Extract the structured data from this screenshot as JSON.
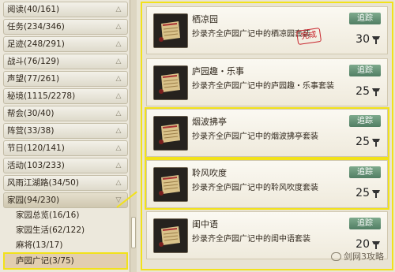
{
  "sidebar": {
    "categories": [
      {
        "label": "阅读(40/161)"
      },
      {
        "label": "任务(234/346)"
      },
      {
        "label": "足迹(248/291)"
      },
      {
        "label": "战斗(76/129)"
      },
      {
        "label": "声望(77/261)"
      },
      {
        "label": "秘境(1115/2278)"
      },
      {
        "label": "帮会(30/40)"
      },
      {
        "label": "阵营(33/38)"
      },
      {
        "label": "节日(120/141)"
      },
      {
        "label": "活动(103/233)"
      },
      {
        "label": "风雨江湖路(34/50)"
      },
      {
        "label": "家园(94/230)"
      }
    ],
    "subitems": [
      {
        "label": "家园总览(16/16)"
      },
      {
        "label": "家园生活(62/122)"
      },
      {
        "label": "麻将(13/17)"
      },
      {
        "label": "庐园广记(3/75)"
      }
    ]
  },
  "items": [
    {
      "name": "栖凉园",
      "desc": "抄录齐全庐园广记中的栖凉园套装",
      "track": "追踪",
      "price": "30",
      "stamp": "完成"
    },
    {
      "name": "庐园趣・乐事",
      "desc": "抄录齐全庐园广记中的庐园趣・乐事套装",
      "track": "追踪",
      "price": "25"
    },
    {
      "name": "烟波拂亭",
      "desc": "抄录齐全庐园广记中的烟波拂亭套装",
      "track": "追踪",
      "price": "25"
    },
    {
      "name": "聆风吹度",
      "desc": "抄录齐全庐园广记中的聆风吹度套装",
      "track": "追踪",
      "price": "25"
    },
    {
      "name": "闺中语",
      "desc": "抄录齐全庐园广记中的闺中语套装",
      "track": "追踪",
      "price": "20"
    }
  ],
  "watermark": "剑网3攻略",
  "colors": {
    "highlight": "#f2e21a",
    "track_button": "#5f8c70",
    "stamp": "#c7222a"
  },
  "icons": {
    "collapse": "chevron-up-icon",
    "expand": "chevron-down-icon",
    "price": "coin-icon",
    "thumb": "scroll-icon"
  }
}
